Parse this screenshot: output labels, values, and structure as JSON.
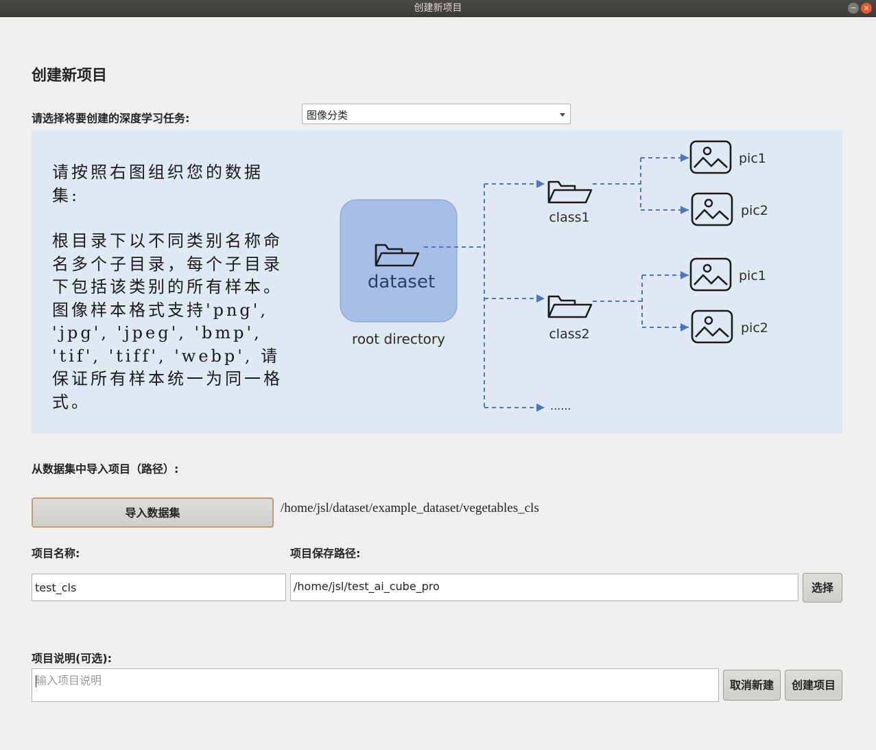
{
  "window": {
    "title": "创建新项目",
    "minimize": "−",
    "close": "×"
  },
  "page": {
    "heading": "创建新项目",
    "task_label": "请选择将要创建的深度学习任务:",
    "task_selected": "图像分类",
    "guide_title": "请按照右图组织您的数据集:",
    "guide_body": "根目录下以不同类别名称命名多个子目录，每个子目录下包括该类别的所有样本。图像样本格式支持'png', 'jpg', 'jpeg', 'bmp', 'tif', 'tiff', 'webp', 请保证所有样本统一为同一格式。",
    "diagram": {
      "root_label": "dataset",
      "root_caption": "root directory",
      "class1": "class1",
      "class2": "class2",
      "pic1": "pic1",
      "pic2": "pic2",
      "more": "......"
    },
    "import_label": "从数据集中导入项目（路径）:",
    "import_button": "导入数据集",
    "import_path": "/home/jsl/dataset/example_dataset/vegetables_cls",
    "name_label": "项目名称:",
    "name_value": "test_cls",
    "save_label": "项目保存路径:",
    "save_value": "/home/jsl/test_ai_cube_pro",
    "choose_button": "选择",
    "desc_label": "项目说明(可选):",
    "desc_placeholder": "输入项目说明",
    "cancel_button": "取消新建",
    "create_button": "创建项目"
  },
  "colors": {
    "panel_bg": "#dfe8f3",
    "root_box": "#a7bfe6",
    "dash_line": "#4a74c4",
    "button_border": "#c79a68"
  },
  "icons": {
    "folder": "folder-icon",
    "image": "image-icon"
  }
}
